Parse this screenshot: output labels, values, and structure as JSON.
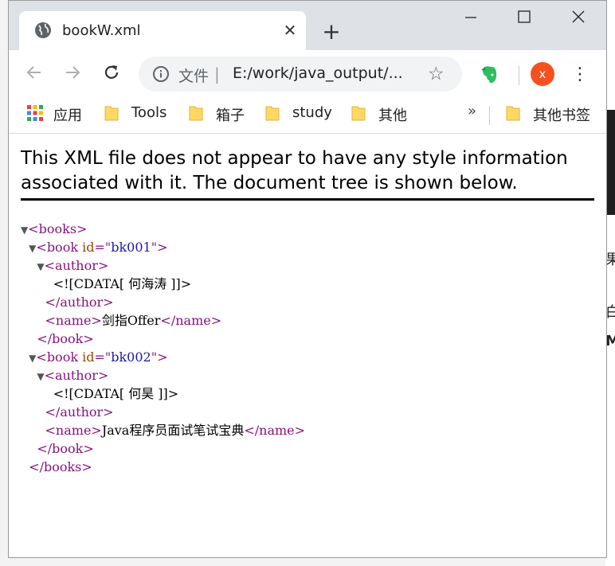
{
  "browser": {
    "tab": {
      "title": "bookW.xml"
    },
    "new_tab": "+",
    "window_controls": {
      "minimize": "—",
      "maximize": "☐",
      "close": "✕"
    },
    "omnibox": {
      "file_label": "文件",
      "separator": "|",
      "url": "E:/work/java_output/..."
    },
    "profile_initial": "x"
  },
  "bookmarks": {
    "items": [
      "应用",
      "Tools",
      "箱子",
      "study",
      "其他"
    ],
    "more": "»",
    "other": "其他书签"
  },
  "page": {
    "header": "This XML file does not appear to have any style information associated with it. The document tree is shown below."
  },
  "xml": {
    "root_open": "<books>",
    "root_close": "</books>",
    "book_open": "<book",
    "book_close": "</book>",
    "author_open": "<author>",
    "author_close": "</author>",
    "name_open": "<name>",
    "name_close": "</name>",
    "attr_name": "id",
    "books": [
      {
        "id": "bk001",
        "cdata": "<![CDATA[ 何海涛 ]]>",
        "name": "剑指Offer"
      },
      {
        "id": "bk002",
        "cdata": "<![CDATA[ 何昊 ]]>",
        "name": "Java程序员面试笔试宝典"
      }
    ]
  },
  "background_text": [
    "果",
    "白",
    "M"
  ],
  "colors": {
    "tag": "#881280",
    "attr": "#994500",
    "value": "#1a1aa6",
    "avatar": "#f4511e",
    "titlebar": "#dee1e6"
  }
}
